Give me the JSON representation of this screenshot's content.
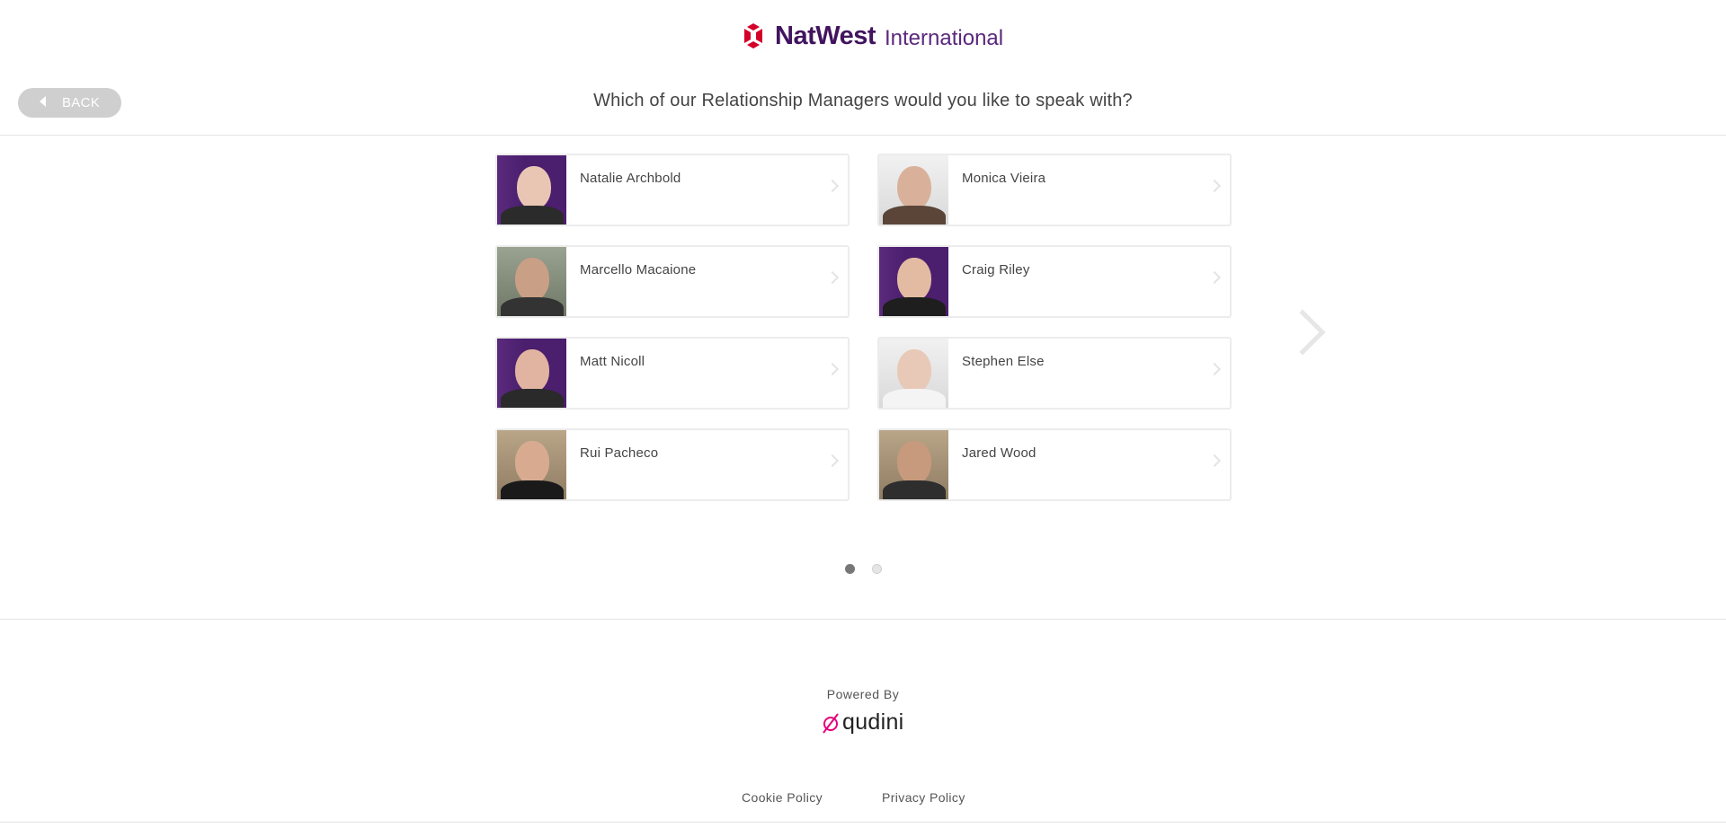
{
  "brand": {
    "name": "NatWest",
    "subname": "International",
    "accent_color": "#42145f",
    "mark_color": "#d4002a"
  },
  "back_button": {
    "label": "BACK",
    "icon": "caret-left-icon"
  },
  "question": "Which of our Relationship Managers would you like to speak with?",
  "managers": [
    {
      "name": "Natalie Archbold"
    },
    {
      "name": "Monica Vieira"
    },
    {
      "name": "Marcello Macaione"
    },
    {
      "name": "Craig Riley"
    },
    {
      "name": "Matt Nicoll"
    },
    {
      "name": "Stephen Else"
    },
    {
      "name": "Rui Pacheco"
    },
    {
      "name": "Jared Wood"
    }
  ],
  "pagination": {
    "current_page": 1,
    "total_pages": 2
  },
  "footer": {
    "powered_by": "Powered By",
    "provider": "qudini",
    "links": [
      "Cookie Policy",
      "Privacy Policy"
    ]
  }
}
